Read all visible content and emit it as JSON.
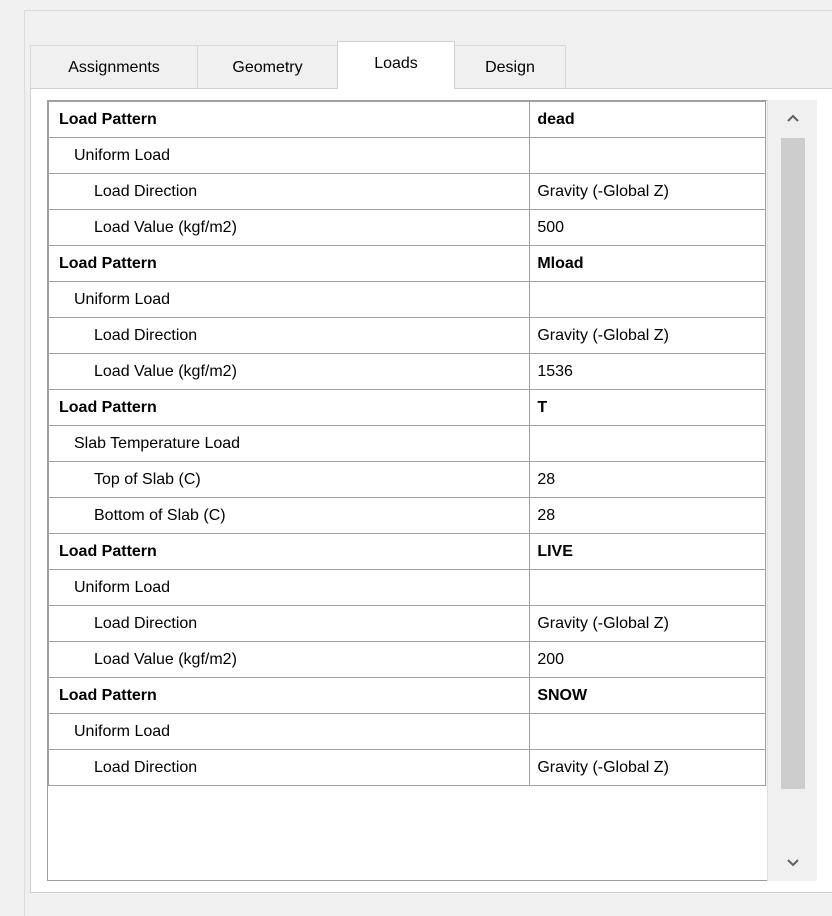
{
  "tabs": [
    {
      "label": "Assignments"
    },
    {
      "label": "Geometry"
    },
    {
      "label": "Loads"
    },
    {
      "label": "Design"
    }
  ],
  "active_tab": "Loads",
  "rows": [
    {
      "label": "Load Pattern",
      "value": "dead"
    },
    {
      "label": "Uniform Load",
      "value": ""
    },
    {
      "label": "Load Direction",
      "value": "Gravity (-Global Z)"
    },
    {
      "label": "Load Value  (kgf/m2)",
      "value": "500"
    },
    {
      "label": "Load Pattern",
      "value": "Mload"
    },
    {
      "label": "Uniform Load",
      "value": ""
    },
    {
      "label": "Load Direction",
      "value": "Gravity (-Global Z)"
    },
    {
      "label": "Load Value  (kgf/m2)",
      "value": "1536"
    },
    {
      "label": "Load Pattern",
      "value": "T"
    },
    {
      "label": "Slab Temperature Load",
      "value": ""
    },
    {
      "label": "Top of Slab  (C)",
      "value": "28"
    },
    {
      "label": "Bottom of Slab  (C)",
      "value": "28"
    },
    {
      "label": "Load Pattern",
      "value": "LIVE"
    },
    {
      "label": "Uniform Load",
      "value": ""
    },
    {
      "label": "Load Direction",
      "value": "Gravity (-Global Z)"
    },
    {
      "label": "Load Value  (kgf/m2)",
      "value": "200"
    },
    {
      "label": "Load Pattern",
      "value": "SNOW"
    },
    {
      "label": "Uniform Load",
      "value": ""
    },
    {
      "label": "Load Direction",
      "value": "Gravity (-Global Z)"
    }
  ],
  "scrollbar": {
    "up_icon": "chevron-up-icon",
    "down_icon": "chevron-down-icon"
  }
}
